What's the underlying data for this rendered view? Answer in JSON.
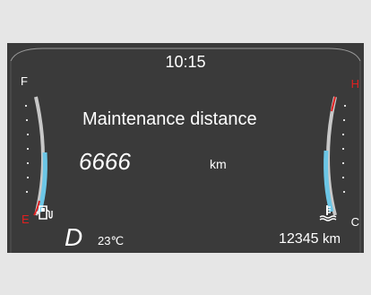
{
  "dashboard": {
    "clock": "10:15",
    "title": "Maintenance distance",
    "distance_value": "6666",
    "distance_unit": "km",
    "gear": "D",
    "outside_temp": "23℃",
    "odometer_value": "12345",
    "odometer_unit": "km"
  },
  "fuel_gauge": {
    "full_label": "F",
    "empty_label": "E",
    "icon": "fuel-pump-icon"
  },
  "temp_gauge": {
    "hot_label": "H",
    "cold_label": "C",
    "icon": "coolant-temperature-icon"
  },
  "colors": {
    "panel": "#3a3a3a",
    "background": "#e6e6e6",
    "text": "#ffffff",
    "gauge_fill": "#6cc6e6",
    "gauge_track": "#c8c8c8",
    "warning": "#e02020"
  }
}
